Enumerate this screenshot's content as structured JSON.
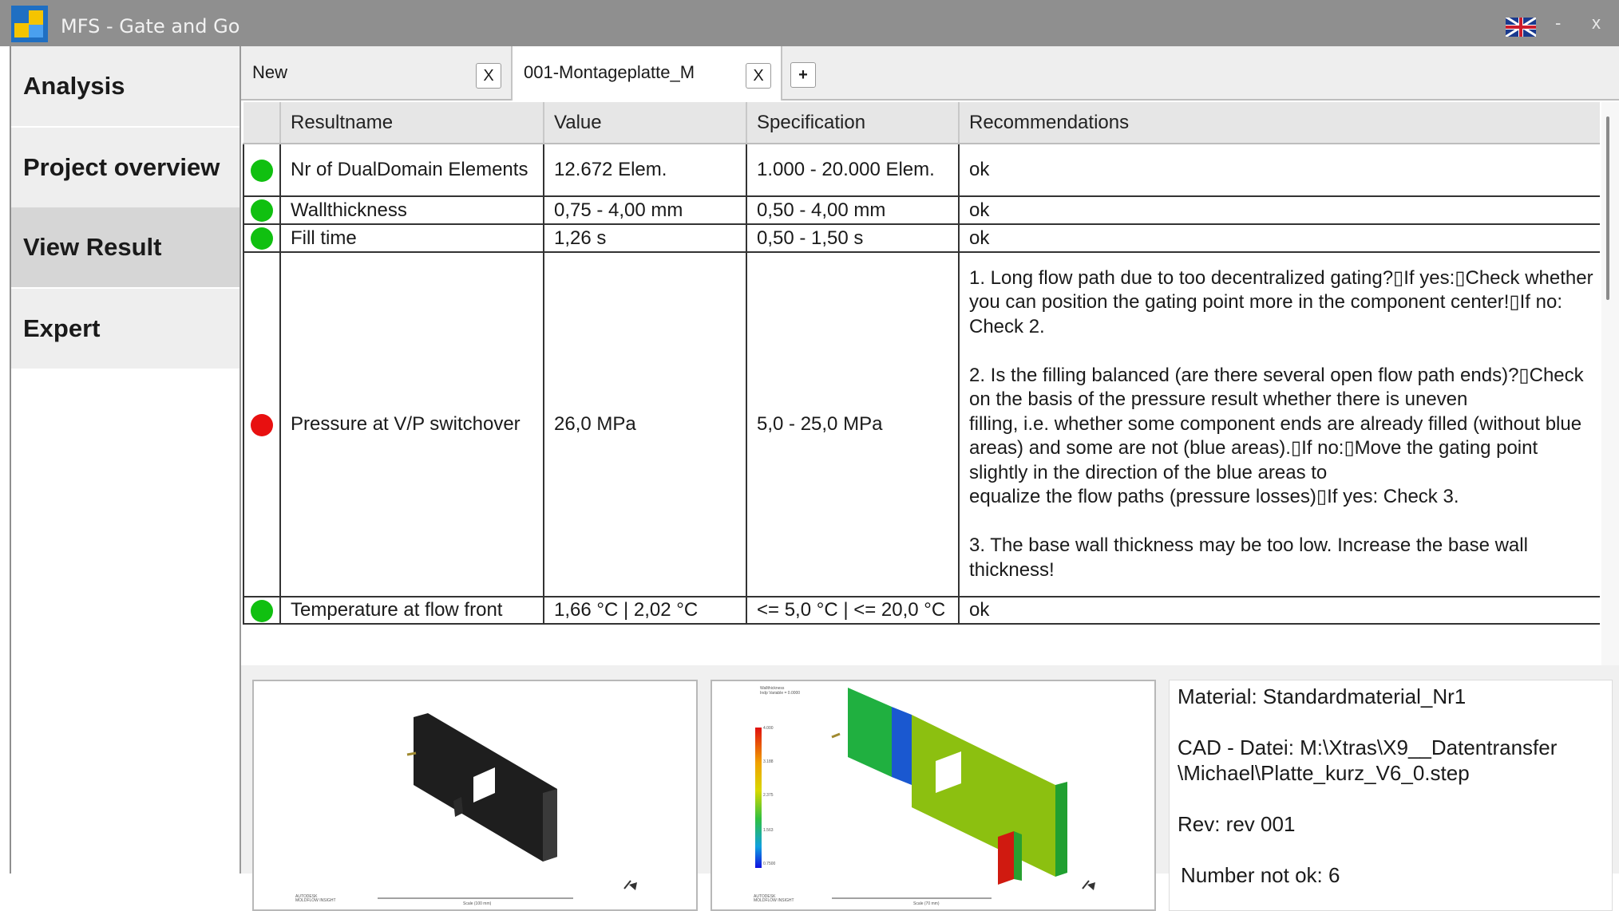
{
  "window": {
    "title": "MFS - Gate and Go",
    "language_flag": "uk-flag-icon",
    "minimize": "-",
    "close": "x"
  },
  "sidebar": {
    "items": [
      {
        "label": "Analysis",
        "active": false
      },
      {
        "label": "Project overview",
        "active": false
      },
      {
        "label": "View Result",
        "active": true
      },
      {
        "label": "Expert",
        "active": false
      }
    ]
  },
  "tabs": {
    "items": [
      {
        "label": "New",
        "close": "X"
      },
      {
        "label": "001-Montageplatte_M",
        "close": "X"
      }
    ],
    "add": "+"
  },
  "table": {
    "headers": [
      "Resultname",
      "Value",
      "Specification",
      "Recommendations"
    ],
    "rows": [
      {
        "status": "green",
        "name": "Nr of DualDomain Elements",
        "value": "12.672 Elem.",
        "spec": "1.000 - 20.000 Elem.",
        "rec": "ok"
      },
      {
        "status": "green",
        "name": "Wallthickness",
        "value": "0,75 - 4,00 mm",
        "spec": "0,50 - 4,00 mm",
        "rec": "ok"
      },
      {
        "status": "green",
        "name": "Fill time",
        "value": "1,26 s",
        "spec": "0,50 - 1,50 s",
        "rec": "ok"
      },
      {
        "status": "red",
        "name": "Pressure at V/P switchover",
        "value": "26,0 MPa",
        "spec": "5,0 - 25,0 MPa",
        "rec": "1. Long flow path due to too decentralized gating?▯If yes:▯Check whether you can position the gating point more in the component center!▯If no: Check 2.\n\n2. Is the filling balanced (are there several open flow path ends)?▯Check on the basis of the pressure result whether there is uneven\nfilling, i.e. whether some component ends are already filled (without blue areas) and some are not (blue areas).▯If no:▯Move the gating point slightly in the direction of the blue areas to\nequalize the flow paths (pressure losses)▯If yes: Check 3.\n\n3. The base wall thickness may be too low. Increase the base wall thickness!"
      },
      {
        "status": "green",
        "name": "Temperature at flow front",
        "value": "1,66 °C | 2,02 °C",
        "spec": "<= 5,0 °C | <= 20,0 °C",
        "rec": "ok"
      }
    ]
  },
  "colors": {
    "ok": "#10c010",
    "not_ok": "#e81010"
  },
  "info": {
    "material": "Material: Standardmaterial_Nr1",
    "cad_line1": "CAD - Datei: M:\\Xtras\\X9__Datentransfer",
    "cad_line2": "\\Michael\\Platte_kurz_V6_0.step",
    "rev": "Rev: rev 001",
    "not_ok": "Number not ok: 6"
  },
  "image_left": {
    "logo": "AUTODESK\nMOLDFLOW INSIGHT",
    "scale": "Scale (100 mm)"
  },
  "image_right": {
    "legend_title": "Wallthickness",
    "legend_sub": "Indp Variable = 0.0000",
    "legend_ticks": [
      "4.000",
      "3.188",
      "2.375",
      "1.563",
      "0.7500"
    ],
    "logo": "AUTODESK\nMOLDFLOW INSIGHT",
    "scale": "Scale (70 mm)"
  }
}
